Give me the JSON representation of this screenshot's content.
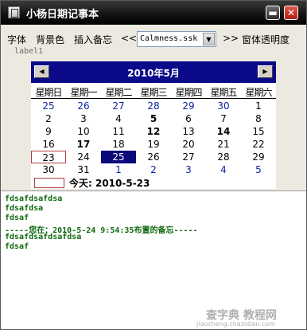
{
  "window": {
    "title": "小杨日期记事本",
    "min_label": "▬",
    "close_label": "✕"
  },
  "menubar": {
    "items": [
      "字体",
      "背景色",
      "插入备忘",
      "<<",
      ">>",
      "窗体透明度"
    ],
    "combo": {
      "value": "Calmness.ssk"
    }
  },
  "label1": "label1",
  "calendar": {
    "title": "2010年5月",
    "prev_label": "◀",
    "next_label": "▶",
    "weekdays": [
      "星期日",
      "星期一",
      "星期二",
      "星期三",
      "星期四",
      "星期五",
      "星期六"
    ],
    "weeks": [
      [
        "25",
        "26",
        "27",
        "28",
        "29",
        "30",
        "1"
      ],
      [
        "2",
        "3",
        "4",
        "5",
        "6",
        "7",
        "8"
      ],
      [
        "9",
        "10",
        "11",
        "12",
        "13",
        "14",
        "15"
      ],
      [
        "16",
        "17",
        "18",
        "19",
        "20",
        "21",
        "22"
      ],
      [
        "23",
        "24",
        "25",
        "26",
        "27",
        "28",
        "29"
      ],
      [
        "30",
        "31",
        "1",
        "2",
        "3",
        "4",
        "5"
      ]
    ],
    "today_text": "今天: 2010-5-23"
  },
  "notes": [
    "fdsafdsafdsa",
    "fdsafdsa",
    "fdsaf",
    " -----您在：2010-5-24 9:54:35布置的备忘-----",
    "fdsafdsafdsafdsa",
    "fdsaf"
  ],
  "watermark": {
    "text": "查字典 教程网",
    "sub": "jiaocheng.chazidian.com"
  },
  "colors": {
    "calendar_header": "#0a0a8a",
    "selected_day": "#0a0a7a",
    "note_text": "#106a10",
    "other_month_day": "#0a24a0"
  }
}
